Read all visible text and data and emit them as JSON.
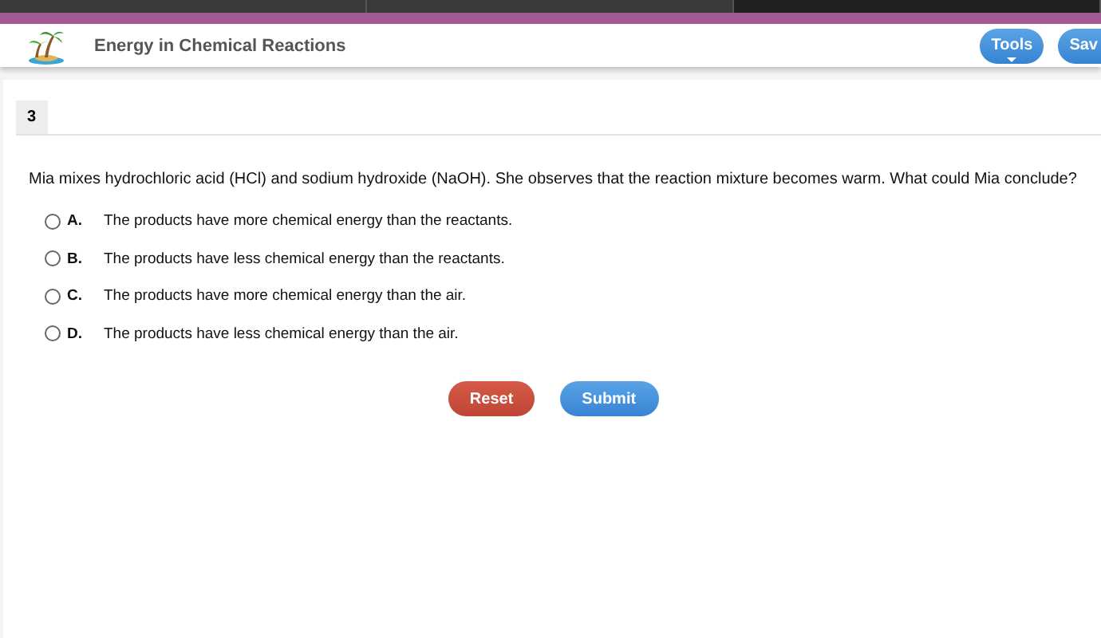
{
  "browser_tabs": [
    {
      "selected": false
    },
    {
      "selected": false
    },
    {
      "selected": true
    }
  ],
  "header": {
    "title": "Energy in Chemical Reactions",
    "buttons": [
      {
        "label": "Tools",
        "kind": "menu"
      },
      {
        "label": "Sav",
        "kind": "plain"
      }
    ]
  },
  "question": {
    "number": "3",
    "prompt": "Mia mixes hydrochloric acid (HCl) and sodium hydroxide (NaOH). She observes that the reaction mixture becomes warm. What could Mia conclude?",
    "options": [
      {
        "letter": "A.",
        "text": "The products have more chemical energy than the reactants.",
        "selected": false
      },
      {
        "letter": "B.",
        "text": "The products have less chemical energy than the reactants.",
        "selected": false
      },
      {
        "letter": "C.",
        "text": "The products have more chemical energy than the air.",
        "selected": false
      },
      {
        "letter": "D.",
        "text": "The products have less chemical energy than the air.",
        "selected": false
      }
    ]
  },
  "actions": [
    {
      "label": "Reset",
      "kind": "reset"
    },
    {
      "label": "Submit",
      "kind": "submit"
    }
  ]
}
